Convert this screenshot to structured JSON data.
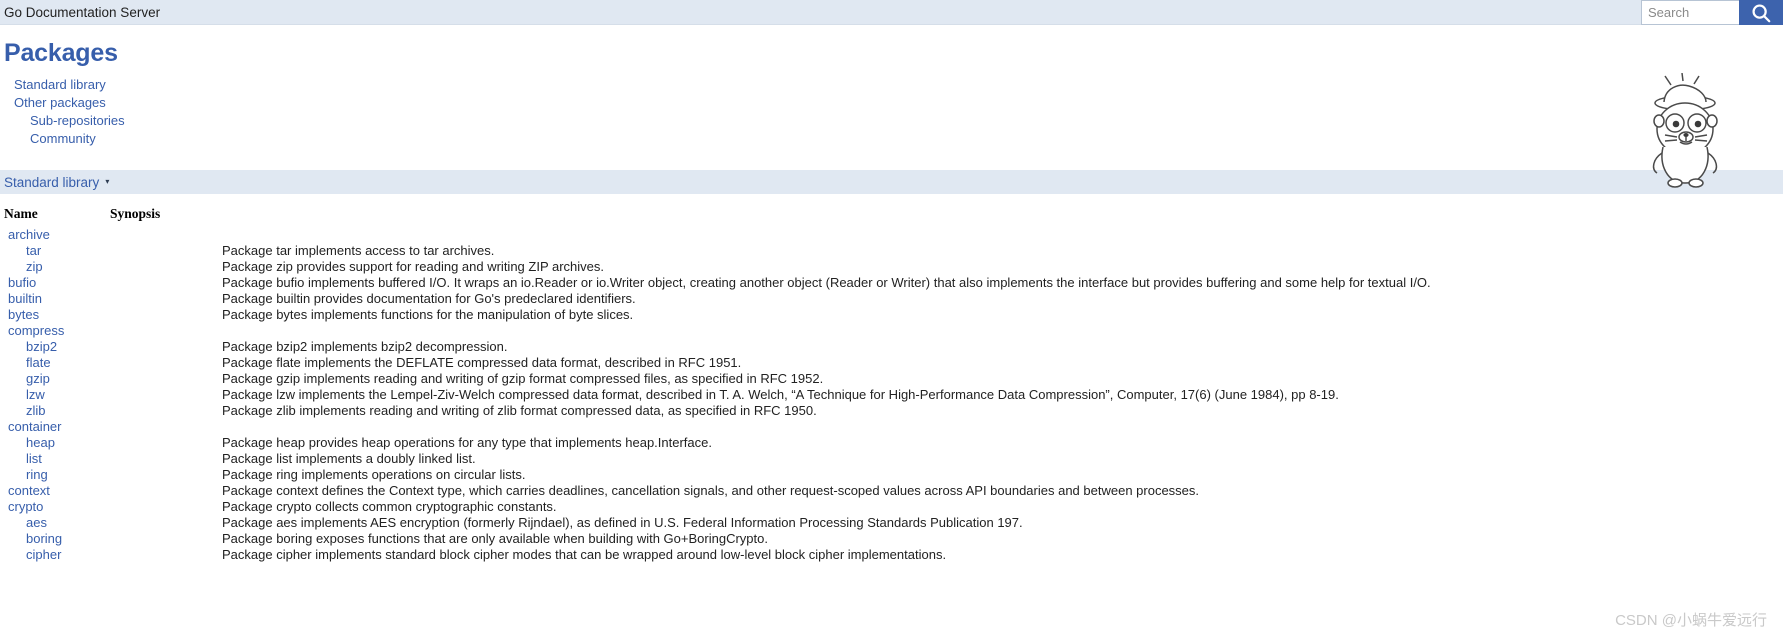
{
  "header": {
    "title": "Go Documentation Server",
    "search_placeholder": "Search",
    "search_value": "",
    "search_icon": "search-icon"
  },
  "main": {
    "page_title": "Packages",
    "nav": [
      {
        "label": "Standard library",
        "level": 1
      },
      {
        "label": "Other packages",
        "level": 1
      },
      {
        "label": "Sub-repositories",
        "level": 2
      },
      {
        "label": "Community",
        "level": 2
      }
    ],
    "section": {
      "label": "Standard library",
      "caret": "▾"
    },
    "table": {
      "headers": {
        "name": "Name",
        "synopsis": "Synopsis"
      },
      "rows": [
        {
          "name": "archive",
          "indent": 0,
          "synopsis": ""
        },
        {
          "name": "tar",
          "indent": 1,
          "synopsis": "Package tar implements access to tar archives."
        },
        {
          "name": "zip",
          "indent": 1,
          "synopsis": "Package zip provides support for reading and writing ZIP archives."
        },
        {
          "name": "bufio",
          "indent": 0,
          "synopsis": "Package bufio implements buffered I/O. It wraps an io.Reader or io.Writer object, creating another object (Reader or Writer) that also implements the interface but provides buffering and some help for textual I/O."
        },
        {
          "name": "builtin",
          "indent": 0,
          "synopsis": "Package builtin provides documentation for Go's predeclared identifiers."
        },
        {
          "name": "bytes",
          "indent": 0,
          "synopsis": "Package bytes implements functions for the manipulation of byte slices."
        },
        {
          "name": "compress",
          "indent": 0,
          "synopsis": ""
        },
        {
          "name": "bzip2",
          "indent": 1,
          "synopsis": "Package bzip2 implements bzip2 decompression."
        },
        {
          "name": "flate",
          "indent": 1,
          "synopsis": "Package flate implements the DEFLATE compressed data format, described in RFC 1951."
        },
        {
          "name": "gzip",
          "indent": 1,
          "synopsis": "Package gzip implements reading and writing of gzip format compressed files, as specified in RFC 1952."
        },
        {
          "name": "lzw",
          "indent": 1,
          "synopsis": "Package lzw implements the Lempel-Ziv-Welch compressed data format, described in T. A. Welch, “A Technique for High-Performance Data Compression”, Computer, 17(6) (June 1984), pp 8-19."
        },
        {
          "name": "zlib",
          "indent": 1,
          "synopsis": "Package zlib implements reading and writing of zlib format compressed data, as specified in RFC 1950."
        },
        {
          "name": "container",
          "indent": 0,
          "synopsis": ""
        },
        {
          "name": "heap",
          "indent": 1,
          "synopsis": "Package heap provides heap operations for any type that implements heap.Interface."
        },
        {
          "name": "list",
          "indent": 1,
          "synopsis": "Package list implements a doubly linked list."
        },
        {
          "name": "ring",
          "indent": 1,
          "synopsis": "Package ring implements operations on circular lists."
        },
        {
          "name": "context",
          "indent": 0,
          "synopsis": "Package context defines the Context type, which carries deadlines, cancellation signals, and other request-scoped values across API boundaries and between processes."
        },
        {
          "name": "crypto",
          "indent": 0,
          "synopsis": "Package crypto collects common cryptographic constants."
        },
        {
          "name": "aes",
          "indent": 1,
          "synopsis": "Package aes implements AES encryption (formerly Rijndael), as defined in U.S. Federal Information Processing Standards Publication 197."
        },
        {
          "name": "boring",
          "indent": 1,
          "synopsis": "Package boring exposes functions that are only available when building with Go+BoringCrypto."
        },
        {
          "name": "cipher",
          "indent": 1,
          "synopsis": "Package cipher implements standard block cipher modes that can be wrapped around low-level block cipher implementations."
        }
      ]
    }
  },
  "watermark": {
    "text": "CSDN @小蜗牛爱远行"
  },
  "colors": {
    "accent": "#375eab",
    "bar_bg": "#e0e8f2",
    "search_btn": "#3d63ad",
    "text": "#222222"
  }
}
